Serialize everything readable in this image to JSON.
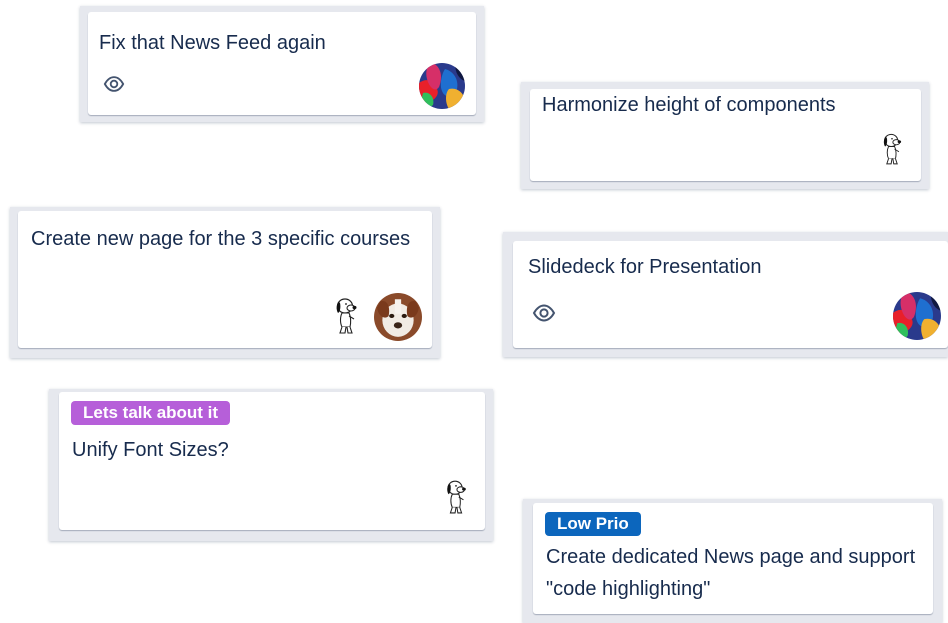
{
  "cards": [
    {
      "title": "Fix that News Feed again",
      "watch_icon": "eye-icon",
      "members": [
        "colorful-avatar"
      ]
    },
    {
      "title": "Harmonize height of components",
      "members": [
        "snoopy-avatar"
      ]
    },
    {
      "title": "Create new page for the 3 specific courses",
      "members": [
        "snoopy-avatar",
        "dog-photo-avatar"
      ]
    },
    {
      "title": "Slidedeck for Presentation",
      "watch_icon": "eye-icon",
      "members": [
        "colorful-avatar"
      ]
    },
    {
      "label": {
        "text": "Lets talk about it",
        "color": "#b65fd9"
      },
      "title": "Unify Font Sizes?",
      "members": [
        "snoopy-avatar"
      ]
    },
    {
      "label": {
        "text": "Low Prio",
        "color": "#0c66bd"
      },
      "title": "Create dedicated News page and support \"code highlighting\""
    }
  ],
  "colors": {
    "card_bg": "#ffffff",
    "list_bg": "#e6e8ee",
    "text": "#172b4d"
  }
}
